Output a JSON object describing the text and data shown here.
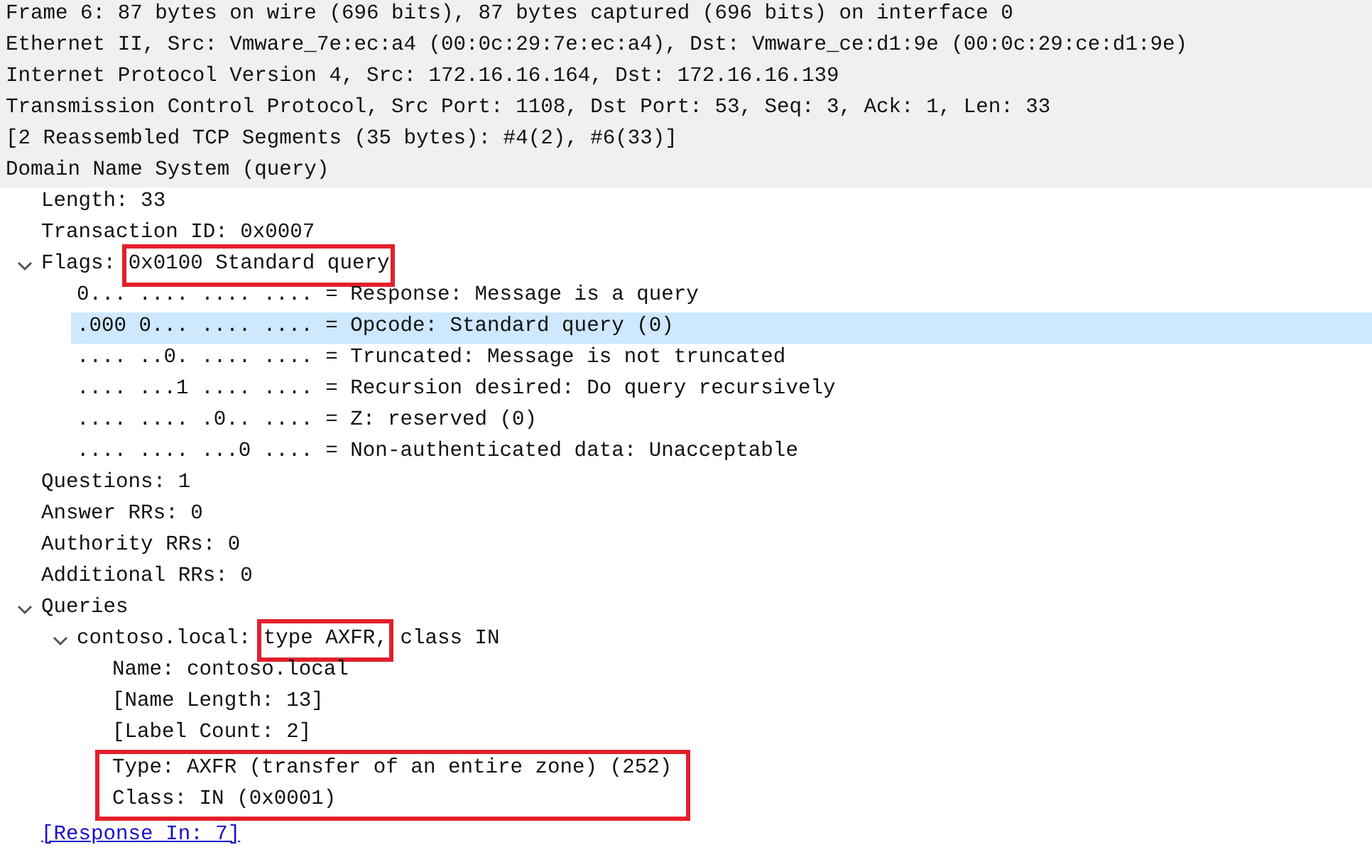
{
  "tree": [
    {
      "kind": "header",
      "selected": false,
      "parts": [
        {
          "text": "Frame 6: 87 bytes on wire (696 bits), 87 bytes captured (696 bits) on interface 0"
        }
      ]
    },
    {
      "kind": "header",
      "selected": false,
      "parts": [
        {
          "text": "Ethernet II, Src: Vmware_7e:ec:a4 (00:0c:29:7e:ec:a4), Dst: Vmware_ce:d1:9e (00:0c:29:ce:d1:9e)"
        }
      ]
    },
    {
      "kind": "header",
      "selected": false,
      "parts": [
        {
          "text": "Internet Protocol Version 4, Src: 172.16.16.164, Dst: 172.16.16.139"
        }
      ]
    },
    {
      "kind": "header",
      "selected": false,
      "parts": [
        {
          "text": "Transmission Control Protocol, Src Port: 1108, Dst Port: 53, Seq: 3, Ack: 1, Len: 33"
        }
      ]
    },
    {
      "kind": "header",
      "selected": false,
      "parts": [
        {
          "text": "[2 Reassembled TCP Segments (35 bytes): #4(2), #6(33)]"
        }
      ]
    },
    {
      "kind": "header",
      "selected": false,
      "parts": [
        {
          "text": "Domain Name System (query)"
        }
      ],
      "children": [
        {
          "kind": "field",
          "selected": false,
          "parts": [
            {
              "text": "Length: 33"
            }
          ]
        },
        {
          "kind": "field",
          "selected": false,
          "parts": [
            {
              "text": "Transaction ID: 0x0007"
            }
          ]
        },
        {
          "kind": "field",
          "selected": false,
          "expanded": true,
          "parts": [
            {
              "text": "Flags: "
            },
            {
              "text": "0x0100 Standard query",
              "boxed": true
            }
          ],
          "children": [
            {
              "kind": "field",
              "selected": false,
              "parts": [
                {
                  "text": "0... .... .... .... = Response: Message is a query"
                }
              ]
            },
            {
              "kind": "field",
              "selected": true,
              "parts": [
                {
                  "text": ".000 0... .... .... = Opcode: Standard query (0)"
                }
              ]
            },
            {
              "kind": "field",
              "selected": false,
              "parts": [
                {
                  "text": ".... ..0. .... .... = Truncated: Message is not truncated"
                }
              ]
            },
            {
              "kind": "field",
              "selected": false,
              "parts": [
                {
                  "text": ".... ...1 .... .... = Recursion desired: Do query recursively"
                }
              ]
            },
            {
              "kind": "field",
              "selected": false,
              "parts": [
                {
                  "text": ".... .... .0.. .... = Z: reserved (0)"
                }
              ]
            },
            {
              "kind": "field",
              "selected": false,
              "parts": [
                {
                  "text": ".... .... ...0 .... = Non-authenticated data: Unacceptable"
                }
              ]
            }
          ]
        },
        {
          "kind": "field",
          "selected": false,
          "parts": [
            {
              "text": "Questions: 1"
            }
          ]
        },
        {
          "kind": "field",
          "selected": false,
          "parts": [
            {
              "text": "Answer RRs: 0"
            }
          ]
        },
        {
          "kind": "field",
          "selected": false,
          "parts": [
            {
              "text": "Authority RRs: 0"
            }
          ]
        },
        {
          "kind": "field",
          "selected": false,
          "parts": [
            {
              "text": "Additional RRs: 0"
            }
          ]
        },
        {
          "kind": "field",
          "selected": false,
          "expanded": true,
          "parts": [
            {
              "text": "Queries"
            }
          ],
          "children": [
            {
              "kind": "field",
              "selected": false,
              "expanded": true,
              "parts": [
                {
                  "text": "contoso.local: "
                },
                {
                  "text": "type AXFR,",
                  "boxed": true
                },
                {
                  "text": " class IN"
                }
              ],
              "children": [
                {
                  "kind": "field",
                  "selected": false,
                  "parts": [
                    {
                      "text": "Name: contoso.local"
                    }
                  ]
                },
                {
                  "kind": "field",
                  "selected": false,
                  "parts": [
                    {
                      "text": "[Name Length: 13]"
                    }
                  ]
                },
                {
                  "kind": "field",
                  "selected": false,
                  "parts": [
                    {
                      "text": "[Label Count: 2]"
                    }
                  ]
                },
                {
                  "kind": "field",
                  "selected": false,
                  "boxed": true,
                  "parts": [
                    {
                      "text": "Type: AXFR (transfer of an entire zone) (252)"
                    }
                  ]
                },
                {
                  "kind": "field",
                  "selected": false,
                  "boxed": true,
                  "parts": [
                    {
                      "text": "Class: IN (0x0001)"
                    }
                  ]
                }
              ]
            }
          ]
        },
        {
          "kind": "link",
          "selected": false,
          "parts": [
            {
              "text": "[Response In: 7]"
            }
          ]
        }
      ]
    }
  ]
}
